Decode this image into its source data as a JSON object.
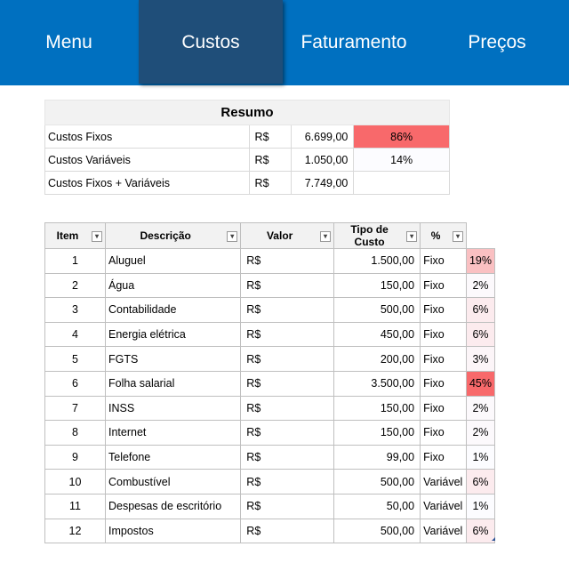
{
  "nav": {
    "items": [
      {
        "label": "Menu",
        "active": false
      },
      {
        "label": "Custos",
        "active": true
      },
      {
        "label": "Faturamento",
        "active": false
      },
      {
        "label": "Preços",
        "active": false
      }
    ],
    "colors": {
      "bar": "#0070c0",
      "active": "#1f4e79",
      "text": "#ffffff"
    }
  },
  "summary": {
    "title": "Resumo",
    "rows": [
      {
        "label": "Custos Fixos",
        "currency": "R$",
        "value": "6.699,00",
        "pct": "86%"
      },
      {
        "label": "Custos Variáveis",
        "currency": "R$",
        "value": "1.050,00",
        "pct": "14%"
      },
      {
        "label": "Custos Fixos + Variáveis",
        "currency": "R$",
        "value": "7.749,00",
        "pct": ""
      }
    ]
  },
  "costs": {
    "headers": {
      "item": "Item",
      "descricao": "Descrição",
      "valor": "Valor",
      "tipo": "Tipo de Custo",
      "pct": "%"
    },
    "filter_icon": "▾",
    "rows": [
      {
        "item": "1",
        "desc": "Aluguel",
        "cur": "R$",
        "valor": "1.500,00",
        "tipo": "Fixo",
        "pct": "19%"
      },
      {
        "item": "2",
        "desc": "Água",
        "cur": "R$",
        "valor": "150,00",
        "tipo": "Fixo",
        "pct": "2%"
      },
      {
        "item": "3",
        "desc": "Contabilidade",
        "cur": "R$",
        "valor": "500,00",
        "tipo": "Fixo",
        "pct": "6%"
      },
      {
        "item": "4",
        "desc": "Energia elétrica",
        "cur": "R$",
        "valor": "450,00",
        "tipo": "Fixo",
        "pct": "6%"
      },
      {
        "item": "5",
        "desc": "FGTS",
        "cur": "R$",
        "valor": "200,00",
        "tipo": "Fixo",
        "pct": "3%"
      },
      {
        "item": "6",
        "desc": "Folha salarial",
        "cur": "R$",
        "valor": "3.500,00",
        "tipo": "Fixo",
        "pct": "45%"
      },
      {
        "item": "7",
        "desc": "INSS",
        "cur": "R$",
        "valor": "150,00",
        "tipo": "Fixo",
        "pct": "2%"
      },
      {
        "item": "8",
        "desc": "Internet",
        "cur": "R$",
        "valor": "150,00",
        "tipo": "Fixo",
        "pct": "2%"
      },
      {
        "item": "9",
        "desc": "Telefone",
        "cur": "R$",
        "valor": "99,00",
        "tipo": "Fixo",
        "pct": "1%"
      },
      {
        "item": "10",
        "desc": "Combustível",
        "cur": "R$",
        "valor": "500,00",
        "tipo": "Variável",
        "pct": "6%"
      },
      {
        "item": "11",
        "desc": "Despesas de escritório",
        "cur": "R$",
        "valor": "50,00",
        "tipo": "Variável",
        "pct": "1%"
      },
      {
        "item": "12",
        "desc": "Impostos",
        "cur": "R$",
        "valor": "500,00",
        "tipo": "Variável",
        "pct": "6%"
      }
    ]
  },
  "heat_colors": {
    "high": "#f8696b",
    "low": "#fcfcff"
  }
}
